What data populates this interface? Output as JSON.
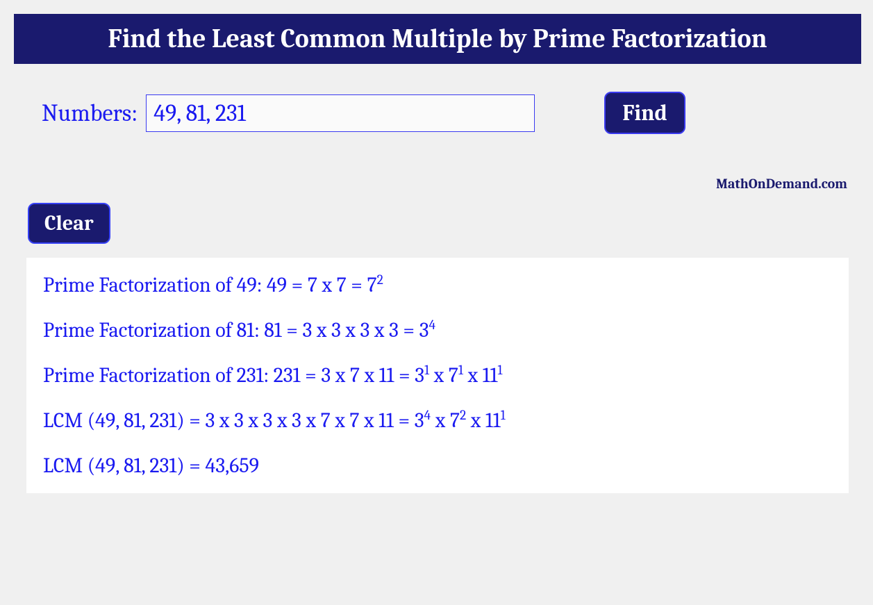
{
  "title": "Find the Least Common Multiple by Prime Factorization",
  "input": {
    "label": "Numbers:",
    "value": "49, 81, 231"
  },
  "buttons": {
    "find": "Find",
    "clear": "Clear"
  },
  "watermark": "MathOnDemand.com",
  "results": {
    "lines": [
      {
        "prefix": "Prime Factorization of 49: 49 = 7 x 7 = 7",
        "sup1": "2",
        "mid1": "",
        "sup2": "",
        "mid2": "",
        "sup3": ""
      },
      {
        "prefix": "Prime Factorization of 81: 81 = 3 x 3 x 3 x 3 = 3",
        "sup1": "4",
        "mid1": "",
        "sup2": "",
        "mid2": "",
        "sup3": ""
      },
      {
        "prefix": "Prime Factorization of 231: 231 = 3 x 7 x 11 = 3",
        "sup1": "1",
        "mid1": " x 7",
        "sup2": "1",
        "mid2": " x 11",
        "sup3": "1"
      },
      {
        "prefix": "LCM (49, 81, 231) = 3 x 3 x 3 x 3 x 7 x 7 x 11 = 3",
        "sup1": "4",
        "mid1": " x 7",
        "sup2": "2",
        "mid2": " x 11",
        "sup3": "1"
      },
      {
        "prefix": "LCM (49, 81, 231) = 43,659",
        "sup1": "",
        "mid1": "",
        "sup2": "",
        "mid2": "",
        "sup3": ""
      }
    ]
  }
}
